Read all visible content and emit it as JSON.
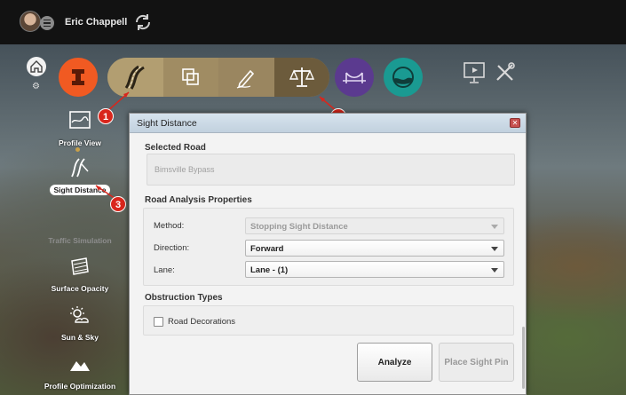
{
  "user": {
    "name": "Eric Chappell"
  },
  "side_tools": [
    {
      "label": "Profile View",
      "state": "normal"
    },
    {
      "label": "Sight Distance",
      "state": "selected"
    },
    {
      "label": "Traffic Simulation",
      "state": "disabled"
    },
    {
      "label": "Surface Opacity",
      "state": "normal"
    },
    {
      "label": "Sun & Sky",
      "state": "normal"
    },
    {
      "label": "Profile Optimization",
      "state": "normal"
    }
  ],
  "callouts": [
    "1",
    "2",
    "3"
  ],
  "dialog": {
    "title": "Sight Distance",
    "selected_road_heading": "Selected Road",
    "selected_road_value": "Bimsville Bypass",
    "properties_heading": "Road Analysis Properties",
    "method_label": "Method:",
    "method_value": "Stopping Sight Distance",
    "direction_label": "Direction:",
    "direction_value": "Forward",
    "lane_label": "Lane:",
    "lane_value": "Lane - (1)",
    "obstruction_heading": "Obstruction Types",
    "road_decorations_label": "Road Decorations",
    "road_decorations_checked": false,
    "analyze_label": "Analyze",
    "place_pin_label": "Place Sight Pin"
  },
  "colors": {
    "toolbar_orange": "#f15a22",
    "toolbar_purple": "#5b3a8f",
    "toolbar_teal": "#1a9a92",
    "group_bar": "#9b8862",
    "callout_red": "#d9261c"
  }
}
